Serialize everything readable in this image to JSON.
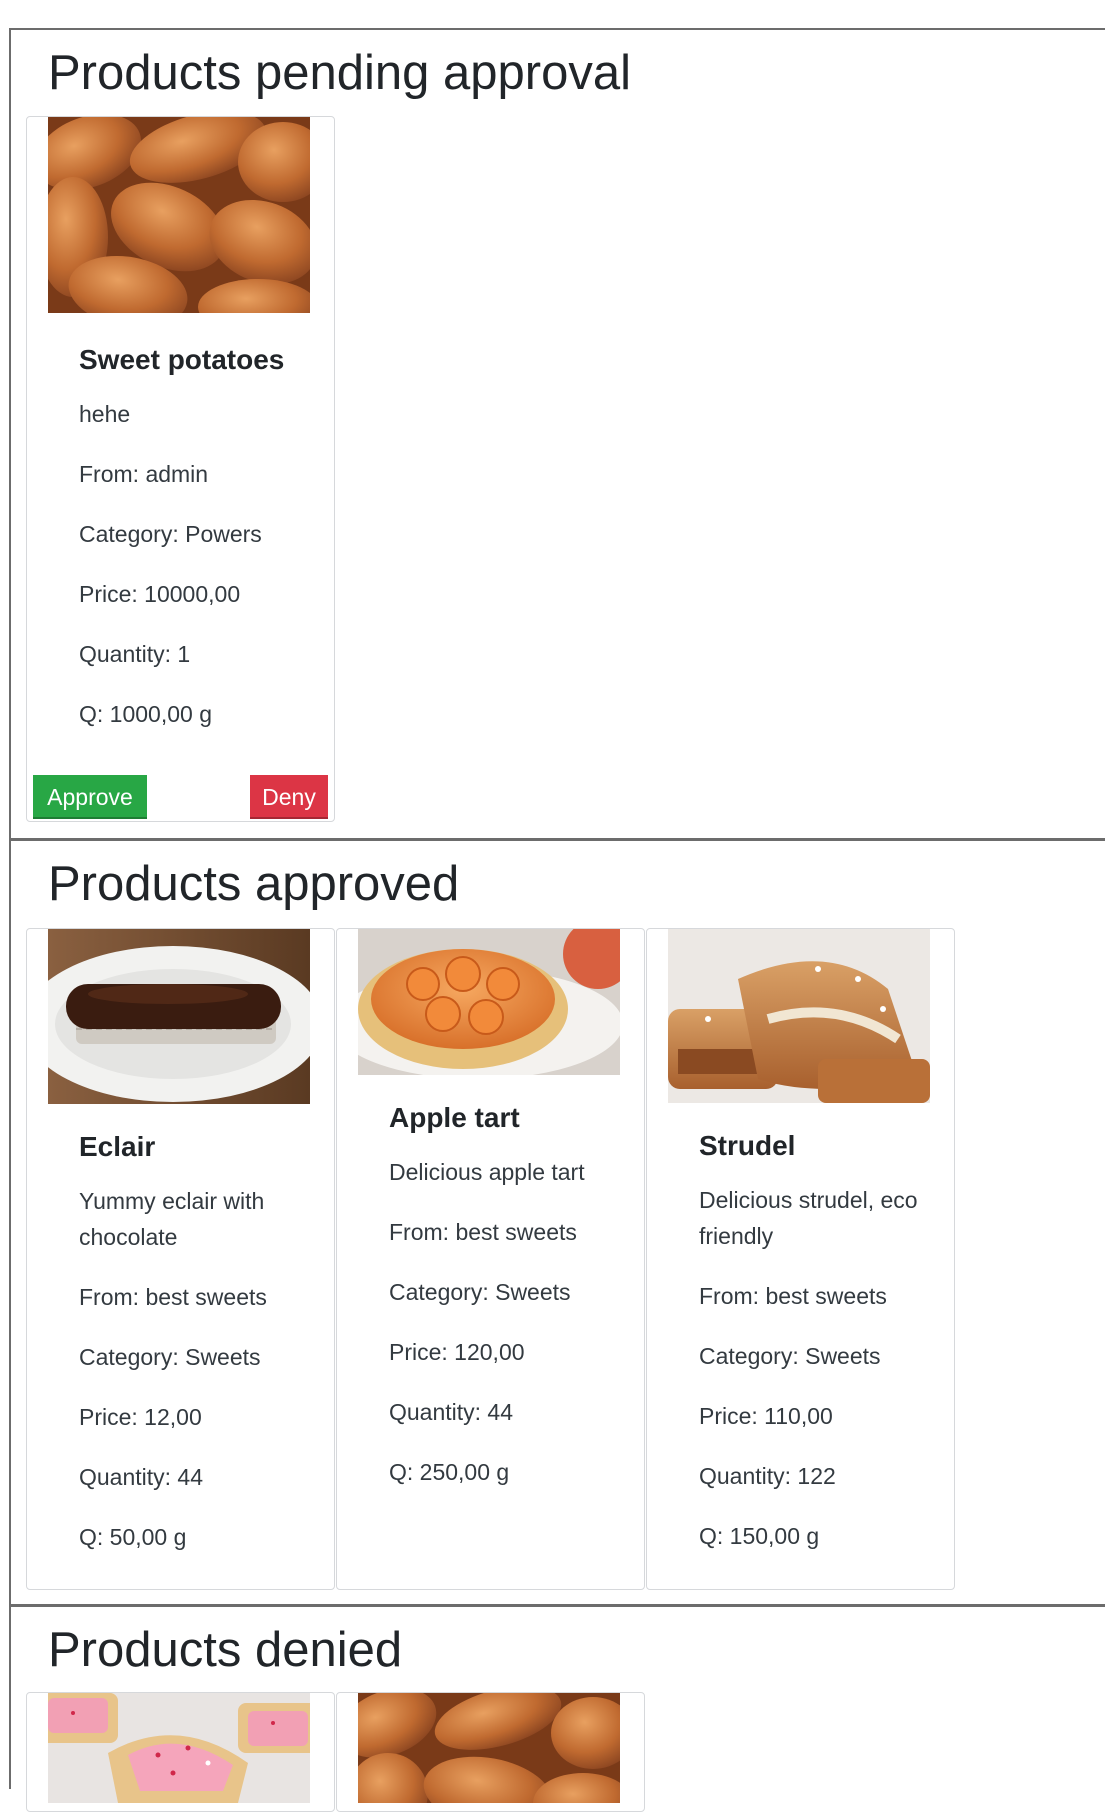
{
  "pending": {
    "heading": "Products pending approval",
    "product": {
      "title": "Sweet potatoes",
      "description": "hehe",
      "from": "From: admin",
      "category": "Category: Powers",
      "price": "Price: 10000,00",
      "quantity": "Quantity: 1",
      "q": "Q: 1000,00 g",
      "image": "sweet-potatoes-photo"
    },
    "approve_label": "Approve",
    "deny_label": "Deny"
  },
  "approved": {
    "heading": "Products approved",
    "products": [
      {
        "title": "Eclair",
        "description": "Yummy eclair with chocolate",
        "from": "From: best sweets",
        "category": "Category: Sweets",
        "price": "Price: 12,00",
        "quantity": "Quantity: 44",
        "q": "Q: 50,00 g",
        "image": "eclair-photo"
      },
      {
        "title": "Apple tart",
        "description": "Delicious apple tart",
        "from": "From: best sweets",
        "category": "Category: Sweets",
        "price": "Price: 120,00",
        "quantity": "Quantity: 44",
        "q": "Q: 250,00 g",
        "image": "apple-tart-photo"
      },
      {
        "title": "Strudel",
        "description": "Delicious strudel, eco friendly",
        "from": "From: best sweets",
        "category": "Category: Sweets",
        "price": "Price: 110,00",
        "quantity": "Quantity: 122",
        "q": "Q: 150,00 g",
        "image": "strudel-photo"
      }
    ]
  },
  "denied": {
    "heading": "Products denied",
    "products": [
      {
        "image": "pop-tart-photo"
      },
      {
        "image": "sweet-potatoes-photo"
      }
    ]
  }
}
